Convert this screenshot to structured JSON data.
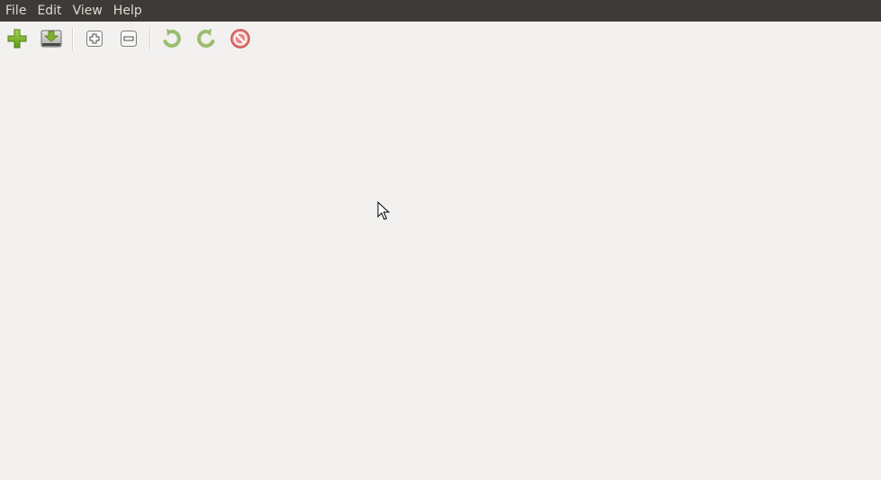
{
  "menubar": {
    "items": [
      {
        "label": "File"
      },
      {
        "label": "Edit"
      },
      {
        "label": "View"
      },
      {
        "label": "Help"
      }
    ]
  },
  "toolbar": {
    "buttons": [
      {
        "name": "add",
        "icon": "plus-icon"
      },
      {
        "name": "download",
        "icon": "download-drive-icon"
      },
      {
        "name": "zoom-in",
        "icon": "small-plus-icon"
      },
      {
        "name": "zoom-out",
        "icon": "small-minus-icon"
      },
      {
        "name": "undo",
        "icon": "undo-arrow-icon"
      },
      {
        "name": "redo",
        "icon": "redo-arrow-icon"
      },
      {
        "name": "stop",
        "icon": "stop-icon"
      }
    ]
  },
  "colors": {
    "menubar_bg": "#3c3b37",
    "menubar_text": "#dfdbd2",
    "window_bg": "#f2f1f0",
    "add_green": "#7cb32b",
    "arrow_green": "#9bbd6e",
    "stop_red": "#d9534f"
  }
}
